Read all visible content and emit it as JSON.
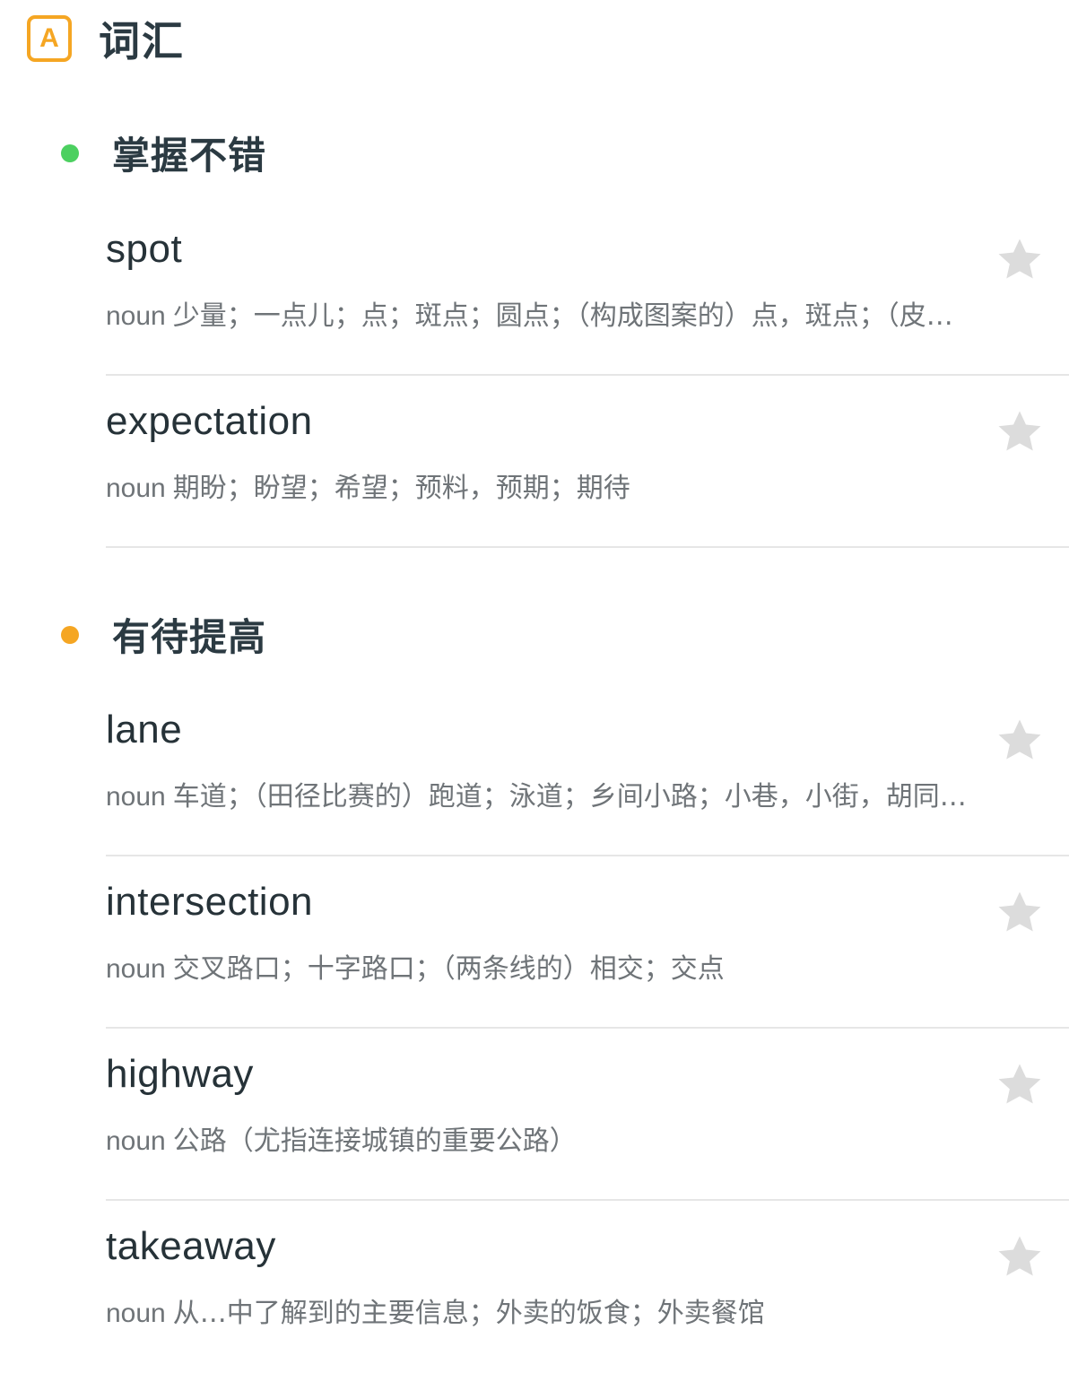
{
  "header": {
    "icon_letter": "A",
    "title": "词汇",
    "accent": "#f5a623"
  },
  "sections": [
    {
      "title": "掌握不错",
      "dot_color": "#4cd060",
      "words": [
        {
          "word": "spot",
          "pos": "noun",
          "definition": "少量；一点儿；点；斑点；圆点；（构成图案的）点，斑点；（皮…",
          "starred": false
        },
        {
          "word": "expectation",
          "pos": "noun",
          "definition": "期盼；盼望；希望；预料，预期；期待",
          "starred": false
        }
      ]
    },
    {
      "title": "有待提高",
      "dot_color": "#f5a623",
      "words": [
        {
          "word": "lane",
          "pos": "noun",
          "definition": "车道；（田径比赛的）跑道；泳道；乡间小路；小巷，小街，胡同…",
          "starred": false
        },
        {
          "word": "intersection",
          "pos": "noun",
          "definition": "交叉路口；十字路口；（两条线的）相交；交点",
          "starred": false
        },
        {
          "word": "highway",
          "pos": "noun",
          "definition": "公路（尤指连接城镇的重要公路）",
          "starred": false
        },
        {
          "word": "takeaway",
          "pos": "noun",
          "definition": "从…中了解到的主要信息；外卖的饭食；外卖餐馆",
          "starred": false
        }
      ]
    }
  ],
  "colors": {
    "star_inactive": "#dcdcdc",
    "divider": "#e6e6e6"
  }
}
